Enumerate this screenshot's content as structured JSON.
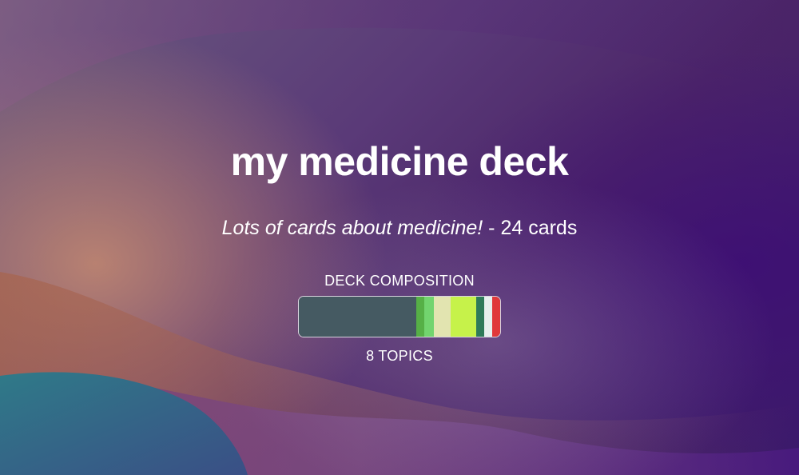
{
  "deck": {
    "title": "my medicine deck",
    "description": "Lots of cards about medicine!",
    "card_count_text": " - 24 cards"
  },
  "composition": {
    "label": "DECK COMPOSITION",
    "topics_label": "8 TOPICS",
    "segments": [
      {
        "fraction": 0.585,
        "color": "#455a62"
      },
      {
        "fraction": 0.04,
        "color": "#56b046"
      },
      {
        "fraction": 0.045,
        "color": "#72d46e"
      },
      {
        "fraction": 0.085,
        "color": "#e2e4b0"
      },
      {
        "fraction": 0.125,
        "color": "#c6f24a"
      },
      {
        "fraction": 0.04,
        "color": "#2e7a5a"
      },
      {
        "fraction": 0.04,
        "color": "#e6f0ee"
      },
      {
        "fraction": 0.04,
        "color": "#e0383a"
      }
    ]
  }
}
